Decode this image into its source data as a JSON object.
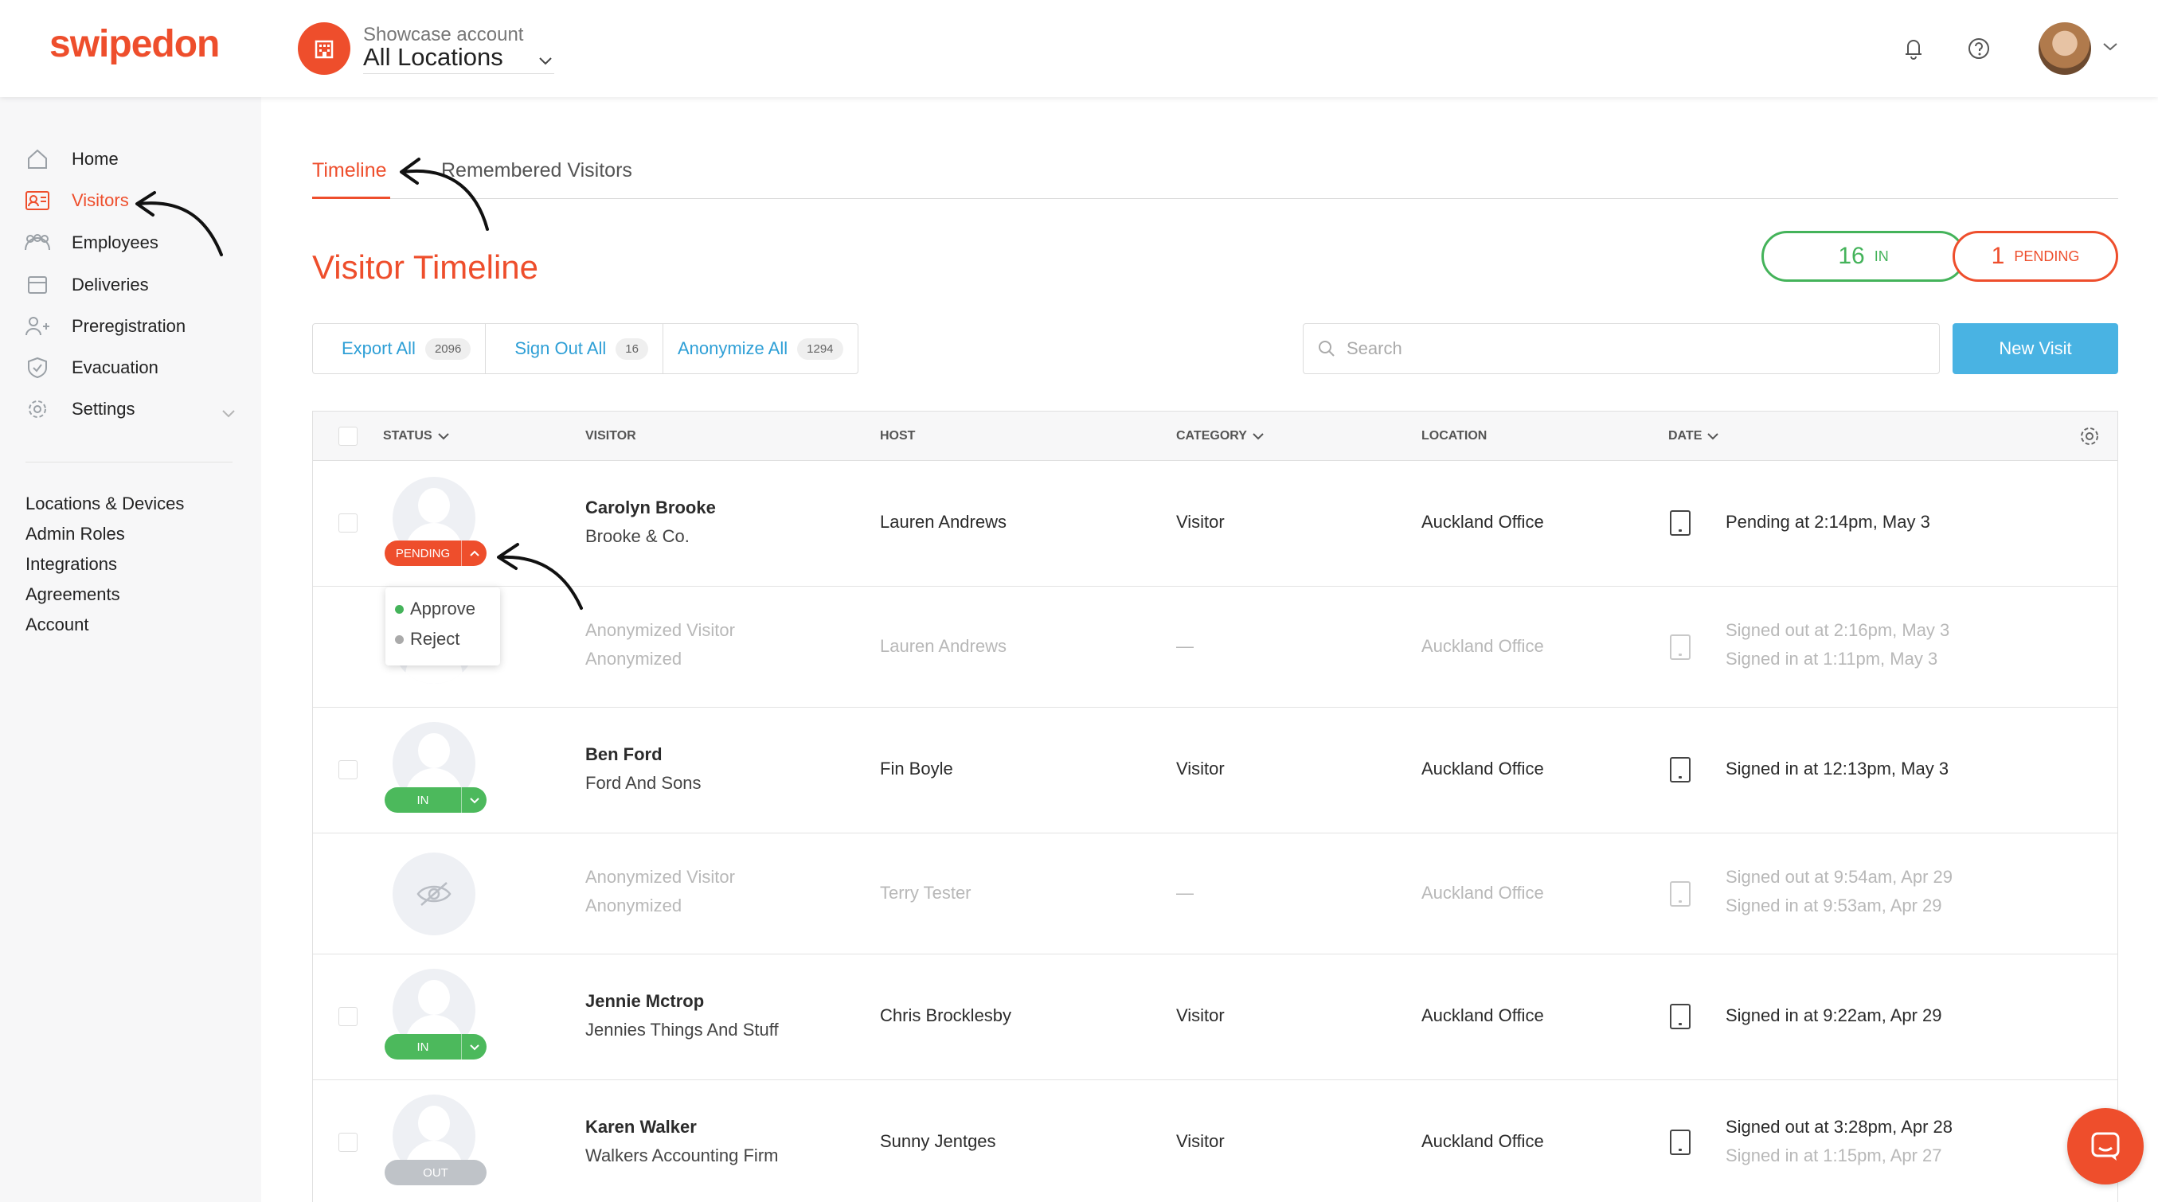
{
  "header": {
    "logo_text": "swipedon",
    "account_label": "Showcase account",
    "location_label": "All Locations",
    "icons": [
      "building-icon",
      "bell-icon",
      "help-icon",
      "avatar",
      "chevron-down-icon"
    ]
  },
  "sidebar": {
    "items": [
      {
        "label": "Home",
        "icon": "home-icon"
      },
      {
        "label": "Visitors",
        "icon": "visitor-card-icon",
        "active": true
      },
      {
        "label": "Employees",
        "icon": "people-icon"
      },
      {
        "label": "Deliveries",
        "icon": "box-icon"
      },
      {
        "label": "Preregistration",
        "icon": "person-plus-icon"
      },
      {
        "label": "Evacuation",
        "icon": "shield-icon"
      },
      {
        "label": "Settings",
        "icon": "gear-icon"
      }
    ],
    "sub_items": [
      "Locations & Devices",
      "Admin Roles",
      "Integrations",
      "Agreements",
      "Account"
    ]
  },
  "tabs": {
    "timeline": "Timeline",
    "remembered": "Remembered Visitors"
  },
  "page": {
    "title": "Visitor Timeline",
    "in_count": "16",
    "in_label": "IN",
    "pending_count": "1",
    "pending_label": "PENDING"
  },
  "toolbar": {
    "export_label": "Export All",
    "export_count": "2096",
    "signout_label": "Sign Out All",
    "signout_count": "16",
    "anonymize_label": "Anonymize All",
    "anonymize_count": "1294",
    "search_placeholder": "Search",
    "new_visit_label": "New Visit"
  },
  "table": {
    "headers": {
      "status": "STATUS",
      "visitor": "VISITOR",
      "host": "HOST",
      "category": "CATEGORY",
      "location": "LOCATION",
      "date": "DATE"
    },
    "rows": [
      {
        "status": "PENDING",
        "name": "Carolyn Brooke",
        "company": "Brooke & Co.",
        "host": "Lauren Andrews",
        "category": "Visitor",
        "location": "Auckland Office",
        "date1": "Pending at 2:14pm, May 3",
        "date2": ""
      },
      {
        "status": "",
        "name": "Anonymized Visitor",
        "company": "Anonymized",
        "host": "Lauren Andrews",
        "category": "—",
        "location": "Auckland Office",
        "date1": "Signed out at 2:16pm, May 3",
        "date2": "Signed in at 1:11pm, May 3"
      },
      {
        "status": "IN",
        "name": "Ben Ford",
        "company": "Ford And Sons",
        "host": "Fin Boyle",
        "category": "Visitor",
        "location": "Auckland Office",
        "date1": "Signed in at 12:13pm, May 3",
        "date2": ""
      },
      {
        "status": "",
        "name": "Anonymized Visitor",
        "company": "Anonymized",
        "host": "Terry Tester",
        "category": "—",
        "location": "Auckland Office",
        "date1": "Signed out at 9:54am, Apr 29",
        "date2": "Signed in at 9:53am, Apr 29"
      },
      {
        "status": "IN",
        "name": "Jennie Mctrop",
        "company": "Jennies Things And Stuff",
        "host": "Chris Brocklesby",
        "category": "Visitor",
        "location": "Auckland Office",
        "date1": "Signed in at 9:22am, Apr 29",
        "date2": ""
      },
      {
        "status": "OUT",
        "name": "Karen Walker",
        "company": "Walkers Accounting Firm",
        "host": "Sunny Jentges",
        "category": "Visitor",
        "location": "Auckland Office",
        "date1": "Signed out at 3:28pm, Apr 28",
        "date2": "Signed in at 1:15pm, Apr 27"
      }
    ]
  },
  "dropdown": {
    "approve": "Approve",
    "reject": "Reject",
    "approve_color": "#44b35a",
    "reject_color": "#aaaaaa"
  },
  "colors": {
    "brand": "#ee4e2c",
    "in": "#4cb95c",
    "link": "#2e9fd6",
    "primary_button": "#49b3e3"
  }
}
